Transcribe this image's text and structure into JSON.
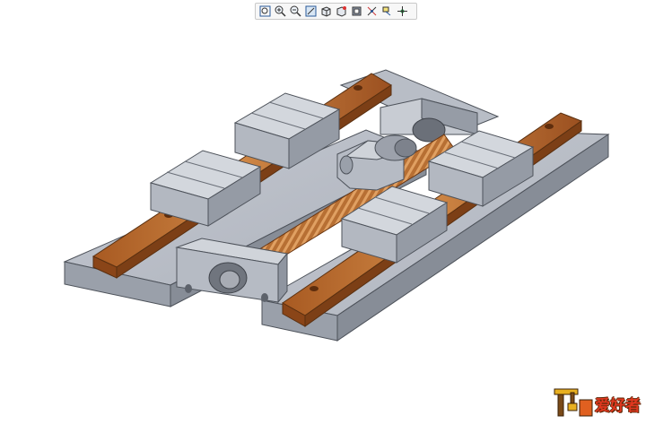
{
  "toolbar": {
    "buttons": [
      {
        "name": "refit-button",
        "icon": "refit-icon"
      },
      {
        "name": "zoom-in-button",
        "icon": "zoom-in-icon"
      },
      {
        "name": "zoom-out-button",
        "icon": "zoom-out-icon"
      },
      {
        "name": "repaint-button",
        "icon": "repaint-icon"
      },
      {
        "name": "view-orientation-button",
        "icon": "cube-icon"
      },
      {
        "name": "saved-views-button",
        "icon": "saved-views-icon"
      },
      {
        "name": "display-style-button",
        "icon": "display-style-icon"
      },
      {
        "name": "datum-display-button",
        "icon": "datum-icon"
      },
      {
        "name": "annotation-display-button",
        "icon": "annotation-icon"
      },
      {
        "name": "spin-center-button",
        "icon": "spin-center-icon"
      }
    ]
  },
  "colors": {
    "toolbar_bg": "#f7f7f7",
    "steel_top": "#b9bec8",
    "steel_side": "#8d939e",
    "rail": "#b86a2e",
    "screw": "#c07a3c"
  },
  "watermark": {
    "text": "爱好者",
    "logo": "crane-logo"
  }
}
